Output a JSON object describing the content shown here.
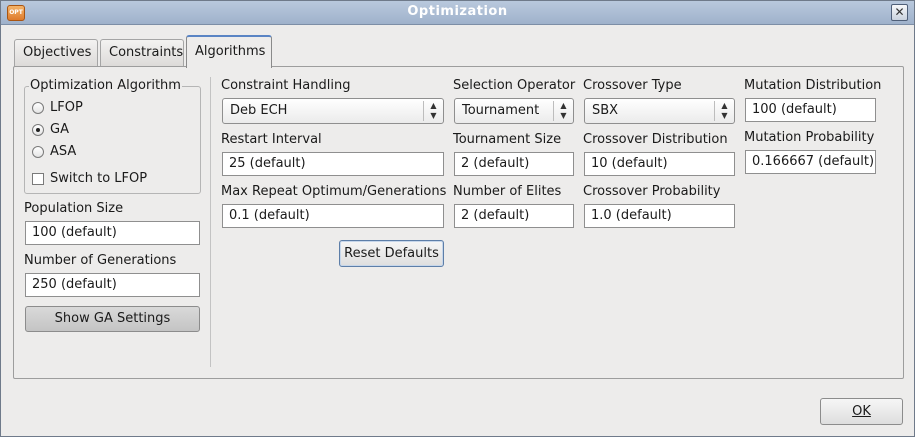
{
  "window": {
    "title": "Optimization",
    "icon_label": "OPT"
  },
  "tabs": [
    {
      "label": "Objectives"
    },
    {
      "label": "Constraints"
    },
    {
      "label": "Algorithms"
    }
  ],
  "algorithm_group": {
    "title": "Optimization Algorithm",
    "options": [
      {
        "label": "LFOP",
        "checked": false
      },
      {
        "label": "GA",
        "checked": true
      },
      {
        "label": "ASA",
        "checked": false
      }
    ],
    "switch_label": "Switch to LFOP"
  },
  "population": {
    "label": "Population Size",
    "value": "100 (default)"
  },
  "generations": {
    "label": "Number of Generations",
    "value": "250 (default)"
  },
  "show_ga_button": "Show GA Settings",
  "constraint_handling": {
    "label": "Constraint Handling",
    "value": "Deb ECH"
  },
  "restart_interval": {
    "label": "Restart Interval",
    "value": "25 (default)"
  },
  "max_repeat": {
    "label": "Max Repeat Optimum/Generations",
    "value": "0.1 (default)"
  },
  "reset_button": "Reset Defaults",
  "selection_operator": {
    "label": "Selection Operator",
    "value": "Tournament"
  },
  "tournament_size": {
    "label": "Tournament Size",
    "value": "2 (default)"
  },
  "num_elites": {
    "label": "Number of Elites",
    "value": "2 (default)"
  },
  "crossover_type": {
    "label": "Crossover Type",
    "value": "SBX"
  },
  "crossover_distribution": {
    "label": "Crossover Distribution",
    "value": "10 (default)"
  },
  "crossover_probability": {
    "label": "Crossover Probability",
    "value": "1.0 (default)"
  },
  "mutation_distribution": {
    "label": "Mutation Distribution",
    "value": "100 (default)"
  },
  "mutation_probability": {
    "label": "Mutation Probability",
    "value": "0.166667 (default)"
  },
  "ok_button": "OK"
}
